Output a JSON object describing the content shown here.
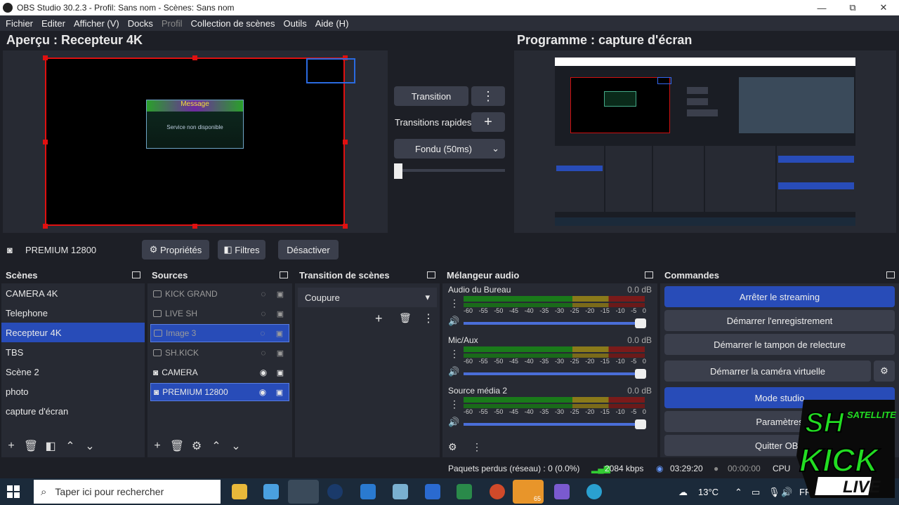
{
  "window": {
    "title": "OBS Studio 30.2.3 - Profil: Sans nom - Scènes: Sans nom",
    "min": "—",
    "max": "⧉",
    "close": "✕"
  },
  "menu": [
    {
      "label": "Fichier"
    },
    {
      "label": "Editer"
    },
    {
      "label": "Afficher (V)"
    },
    {
      "label": "Docks"
    },
    {
      "label": "Profil"
    },
    {
      "label": "Collection de scènes"
    },
    {
      "label": "Outils"
    },
    {
      "label": "Aide (H)"
    }
  ],
  "preview": {
    "title": "Aperçu : Recepteur 4K",
    "message_title": "Message",
    "message_body": "Service non disponible"
  },
  "program": {
    "title": "Programme : capture d'écran"
  },
  "transition": {
    "button": "Transition",
    "menu": "⋮",
    "quick": "Transitions rapides",
    "add": "+",
    "select": "Fondu (50ms)"
  },
  "source_bar": {
    "name": "PREMIUM 12800",
    "properties": "Propriétés",
    "filters": "Filtres",
    "deactivate": "Désactiver"
  },
  "scenes": {
    "title": "Scènes",
    "items": [
      {
        "label": "CAMERA 4K"
      },
      {
        "label": "Telephone"
      },
      {
        "label": "Recepteur 4K"
      },
      {
        "label": "TBS"
      },
      {
        "label": "Scène 2"
      },
      {
        "label": "photo"
      },
      {
        "label": "capture d'écran"
      }
    ]
  },
  "sources": {
    "title": "Sources",
    "items": [
      {
        "label": "KICK GRAND"
      },
      {
        "label": "LIVE SH"
      },
      {
        "label": "Image 3"
      },
      {
        "label": "SH.KICK"
      },
      {
        "label": "CAMERA"
      },
      {
        "label": "PREMIUM 12800"
      }
    ]
  },
  "scene_transition": {
    "title": "Transition de scènes",
    "select": "Coupure"
  },
  "mixer": {
    "title": "Mélangeur audio",
    "channels": [
      {
        "name": "Audio du Bureau",
        "db": "0.0 dB"
      },
      {
        "name": "Mic/Aux",
        "db": "0.0 dB"
      },
      {
        "name": "Source média 2",
        "db": "0.0 dB"
      }
    ],
    "scale": [
      "-60",
      "-55",
      "-50",
      "-45",
      "-40",
      "-35",
      "-30",
      "-25",
      "-20",
      "-15",
      "-10",
      "-5",
      "0"
    ]
  },
  "commands": {
    "title": "Commandes",
    "items": [
      {
        "label": "Arrêter le streaming"
      },
      {
        "label": "Démarrer l'enregistrement"
      },
      {
        "label": "Démarrer le tampon de relecture"
      },
      {
        "label": "Démarrer la caméra virtuelle"
      },
      {
        "label": "Mode studio"
      },
      {
        "label": "Paramètres"
      },
      {
        "label": "Quitter OBS"
      }
    ]
  },
  "status": {
    "dropped": "Paquets perdus (réseau) : 0 (0.0%)",
    "bitrate": "2084 kbps",
    "stream_time": "03:29:20",
    "rec_time": "00:00:00",
    "cpu": "CPU"
  },
  "taskbar": {
    "search": "Taper ici pour rechercher",
    "temp": "13°C",
    "lang": "FRA",
    "badge": "65"
  },
  "logo": {
    "line1": "SH",
    "line2": "SATELLITE",
    "line3": "KICK",
    "line4": "LIVE"
  },
  "colors": {
    "accent": "#284cb8",
    "record_red": "#e01010",
    "bg": "#1d1f26",
    "panel": "#272a33"
  }
}
